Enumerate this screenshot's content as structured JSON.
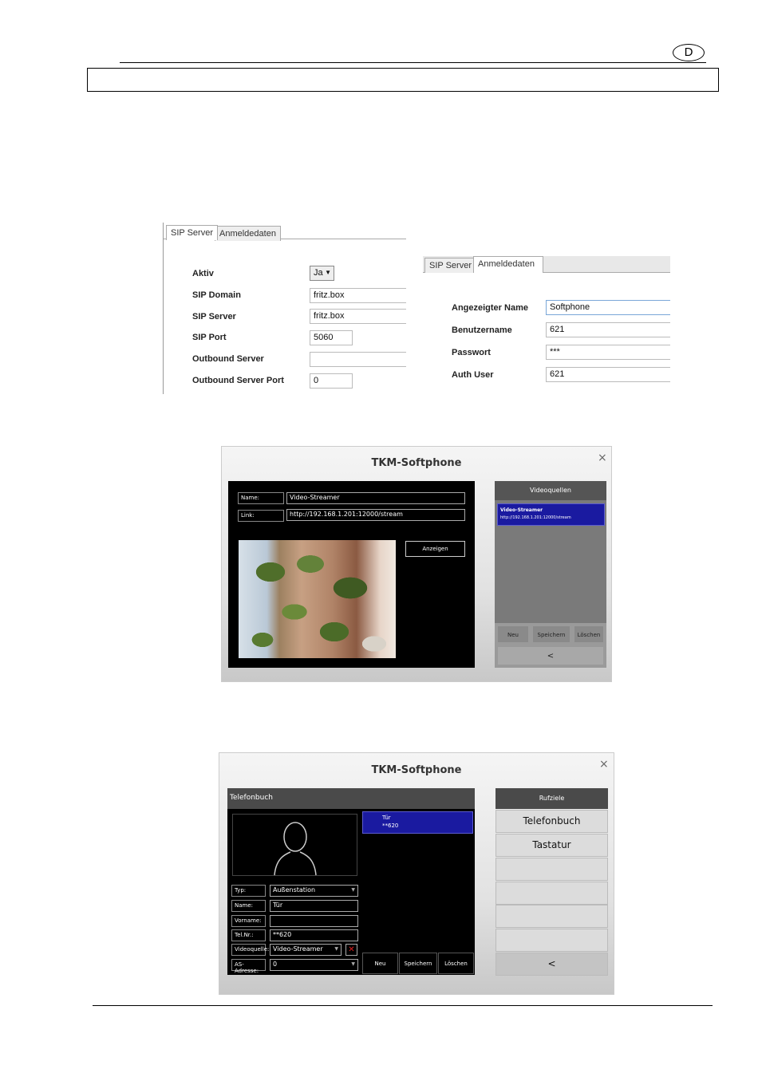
{
  "page": {
    "language_badge": "D"
  },
  "sip_server_tab": {
    "tabs": [
      "SIP Server",
      "Anmeldedaten"
    ],
    "fields": [
      {
        "label": "Aktiv",
        "value": "Ja"
      },
      {
        "label": "SIP Domain",
        "value": "fritz.box"
      },
      {
        "label": "SIP Server",
        "value": "fritz.box"
      },
      {
        "label": "SIP Port",
        "value": "5060"
      },
      {
        "label": "Outbound Server",
        "value": ""
      },
      {
        "label": "Outbound Server Port",
        "value": "0"
      }
    ]
  },
  "credentials_tab": {
    "tabs": [
      "SIP Server",
      "Anmeldedaten"
    ],
    "fields": [
      {
        "label": "Angezeigter Name",
        "value": "Softphone"
      },
      {
        "label": "Benutzername",
        "value": "621"
      },
      {
        "label": "Passwort",
        "value": "***"
      },
      {
        "label": "Auth User",
        "value": "621"
      }
    ]
  },
  "video_dialog": {
    "title": "TKM-Softphone",
    "close": "×",
    "name_label": "Name:",
    "name_value": "Video-Streamer",
    "link_label": "Link:",
    "link_value": "http://192.168.1.201:12000/stream",
    "show_button": "Anzeigen",
    "sources_header": "Videoquellen",
    "source_item_title": "Video-Streamer",
    "source_item_url": "http://192.168.1.201:12000/stream",
    "buttons": [
      "Neu",
      "Speichern",
      "Löschen"
    ],
    "back": "<"
  },
  "phonebook_dialog": {
    "title": "TKM-Softphone",
    "close": "×",
    "section_title": "Telefonbuch",
    "fields": [
      {
        "label": "Typ:",
        "value": "Außenstation"
      },
      {
        "label": "Name:",
        "value": "Tür"
      },
      {
        "label": "Vorname:",
        "value": ""
      },
      {
        "label": "Tel.Nr.:",
        "value": "**620"
      },
      {
        "label": "Videoquelle:",
        "value": "Video-Streamer"
      },
      {
        "label": "AS-Adresse:",
        "value": "0"
      }
    ],
    "entry_name": "Tür",
    "entry_number": "**620",
    "buttons": [
      "Neu",
      "Speichern",
      "Löschen"
    ],
    "side_header": "Rufziele",
    "side_items": [
      "Telefonbuch",
      "Tastatur"
    ],
    "back": "<"
  }
}
